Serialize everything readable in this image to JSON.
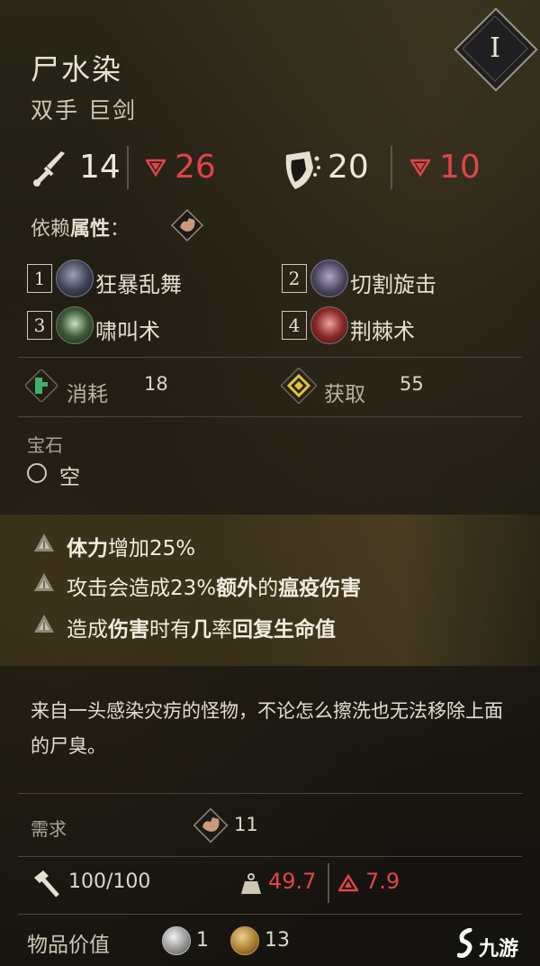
{
  "item": {
    "name": "尸水染",
    "type": "双手 巨剑",
    "tier": "I"
  },
  "stats": {
    "damage": "14",
    "damage_mod": "26",
    "stagger": "20",
    "stagger_mod": "10"
  },
  "scaling": {
    "label": "依赖",
    "label_bold": "属性",
    "colon": "："
  },
  "skills": [
    {
      "num": "1",
      "label": "狂暴乱舞",
      "icon": "whirl-skill-icon"
    },
    {
      "num": "2",
      "label": "切割旋击",
      "icon": "spin-skill-icon"
    },
    {
      "num": "3",
      "label": "啸叫术",
      "icon": "howl-skill-icon"
    },
    {
      "num": "4",
      "label": "荆棘术",
      "icon": "thorn-skill-icon"
    }
  ],
  "resources": {
    "cost_label": "消耗",
    "cost_value": "18",
    "gain_label": "获取",
    "gain_value": "55"
  },
  "gem": {
    "label": "宝石",
    "slot": "空"
  },
  "perks": [
    {
      "parts": [
        {
          "t": "体力",
          "b": true
        },
        {
          "t": "增加25%",
          "b": false
        }
      ]
    },
    {
      "parts": [
        {
          "t": "攻击会造成23%",
          "b": false
        },
        {
          "t": "额外",
          "b": true
        },
        {
          "t": "的",
          "b": false
        },
        {
          "t": "瘟疫伤害",
          "b": true
        }
      ]
    },
    {
      "parts": [
        {
          "t": "造成",
          "b": false
        },
        {
          "t": "伤害",
          "b": true
        },
        {
          "t": "时有",
          "b": false
        },
        {
          "t": "几",
          "b": true
        },
        {
          "t": "率",
          "b": false
        },
        {
          "t": "回复生命值",
          "b": true
        }
      ]
    }
  ],
  "description": "来自一头感染灾疠的怪物，不论怎么擦洗也无法移除上面的尸臭。",
  "requirement": {
    "label": "需求",
    "value": "11"
  },
  "footer": {
    "durability": "100/100",
    "weight": "49.7",
    "weight_extra": "7.9"
  },
  "value": {
    "label": "物品价值",
    "silver": "1",
    "gold": "13"
  },
  "watermark": {
    "text": "九游"
  },
  "colors": {
    "red": "#e0444a",
    "gold_band": "#8a7032"
  }
}
